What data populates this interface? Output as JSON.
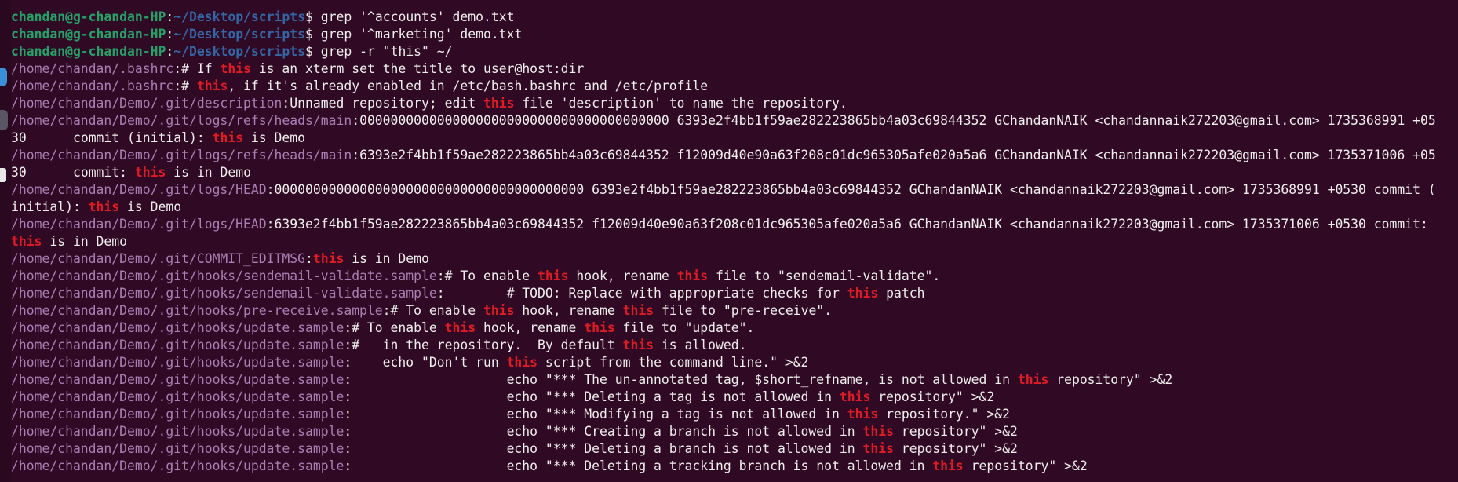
{
  "prompt": {
    "user": "chandan@g-chandan-HP",
    "separator": ":",
    "cwd": "~/Desktop/scripts",
    "dollar": "$ "
  },
  "lines": [
    {
      "kind": "prompt",
      "parts": [
        {
          "t": "grep '^accounts' demo.txt"
        }
      ]
    },
    {
      "kind": "prompt",
      "parts": [
        {
          "t": "grep '^marketing' demo.txt"
        }
      ]
    },
    {
      "kind": "prompt",
      "parts": [
        {
          "t": "grep -r \"this\" ~/"
        }
      ]
    },
    {
      "kind": "output",
      "parts": [
        {
          "t": "/home/chandan/.bashrc",
          "c": "path"
        },
        {
          "t": ":# If "
        },
        {
          "t": "this",
          "c": "hl"
        },
        {
          "t": " is an xterm set the title to user@host:dir"
        }
      ]
    },
    {
      "kind": "output",
      "parts": [
        {
          "t": "/home/chandan/.bashrc",
          "c": "path"
        },
        {
          "t": ":# "
        },
        {
          "t": "this",
          "c": "hl"
        },
        {
          "t": ", if it's already enabled in /etc/bash.bashrc and /etc/profile"
        }
      ]
    },
    {
      "kind": "output",
      "parts": [
        {
          "t": "/home/chandan/Demo/.git/description",
          "c": "path"
        },
        {
          "t": ":Unnamed repository; edit "
        },
        {
          "t": "this",
          "c": "hl"
        },
        {
          "t": " file 'description' to name the repository."
        }
      ]
    },
    {
      "kind": "output",
      "parts": [
        {
          "t": "/home/chandan/Demo/.git/logs/refs/heads/main",
          "c": "path"
        },
        {
          "t": ":0000000000000000000000000000000000000000 6393e2f4bb1f59ae282223865bb4a03c69844352 GChandanNAIK <chandannaik272203@gmail.com> 1735368991 +05"
        }
      ]
    },
    {
      "kind": "output",
      "parts": [
        {
          "t": "30\tcommit (initial): "
        },
        {
          "t": "this",
          "c": "hl"
        },
        {
          "t": " is Demo"
        }
      ]
    },
    {
      "kind": "output",
      "parts": [
        {
          "t": "/home/chandan/Demo/.git/logs/refs/heads/main",
          "c": "path"
        },
        {
          "t": ":6393e2f4bb1f59ae282223865bb4a03c69844352 f12009d40e90a63f208c01dc965305afe020a5a6 GChandanNAIK <chandannaik272203@gmail.com> 1735371006 +05"
        }
      ]
    },
    {
      "kind": "output",
      "parts": [
        {
          "t": "30\tcommit: "
        },
        {
          "t": "this",
          "c": "hl"
        },
        {
          "t": " is in Demo"
        }
      ]
    },
    {
      "kind": "output",
      "parts": [
        {
          "t": "/home/chandan/Demo/.git/logs/HEAD",
          "c": "path"
        },
        {
          "t": ":0000000000000000000000000000000000000000 6393e2f4bb1f59ae282223865bb4a03c69844352 GChandanNAIK <chandannaik272203@gmail.com> 1735368991 +0530 commit ("
        }
      ]
    },
    {
      "kind": "output",
      "parts": [
        {
          "t": "initial): "
        },
        {
          "t": "this",
          "c": "hl"
        },
        {
          "t": " is Demo"
        }
      ]
    },
    {
      "kind": "output",
      "parts": [
        {
          "t": "/home/chandan/Demo/.git/logs/HEAD",
          "c": "path"
        },
        {
          "t": ":6393e2f4bb1f59ae282223865bb4a03c69844352 f12009d40e90a63f208c01dc965305afe020a5a6 GChandanNAIK <chandannaik272203@gmail.com> 1735371006 +0530 commit:"
        }
      ]
    },
    {
      "kind": "output",
      "parts": [
        {
          "t": "this",
          "c": "hl"
        },
        {
          "t": " is in Demo"
        }
      ]
    },
    {
      "kind": "output",
      "parts": [
        {
          "t": "/home/chandan/Demo/.git/COMMIT_EDITMSG",
          "c": "path"
        },
        {
          "t": ":"
        },
        {
          "t": "this",
          "c": "hl"
        },
        {
          "t": " is in Demo"
        }
      ]
    },
    {
      "kind": "output",
      "parts": [
        {
          "t": "/home/chandan/Demo/.git/hooks/sendemail-validate.sample",
          "c": "path"
        },
        {
          "t": ":# To enable "
        },
        {
          "t": "this",
          "c": "hl"
        },
        {
          "t": " hook, rename "
        },
        {
          "t": "this",
          "c": "hl"
        },
        {
          "t": " file to \"sendemail-validate\"."
        }
      ]
    },
    {
      "kind": "output",
      "parts": [
        {
          "t": "/home/chandan/Demo/.git/hooks/sendemail-validate.sample",
          "c": "path"
        },
        {
          "t": ":\t# TODO: Replace with appropriate checks for "
        },
        {
          "t": "this",
          "c": "hl"
        },
        {
          "t": " patch"
        }
      ]
    },
    {
      "kind": "output",
      "parts": [
        {
          "t": "/home/chandan/Demo/.git/hooks/pre-receive.sample",
          "c": "path"
        },
        {
          "t": ":# To enable "
        },
        {
          "t": "this",
          "c": "hl"
        },
        {
          "t": " hook, rename "
        },
        {
          "t": "this",
          "c": "hl"
        },
        {
          "t": " file to \"pre-receive\"."
        }
      ]
    },
    {
      "kind": "output",
      "parts": [
        {
          "t": "/home/chandan/Demo/.git/hooks/update.sample",
          "c": "path"
        },
        {
          "t": ":# To enable "
        },
        {
          "t": "this",
          "c": "hl"
        },
        {
          "t": " hook, rename "
        },
        {
          "t": "this",
          "c": "hl"
        },
        {
          "t": " file to \"update\"."
        }
      ]
    },
    {
      "kind": "output",
      "parts": [
        {
          "t": "/home/chandan/Demo/.git/hooks/update.sample",
          "c": "path"
        },
        {
          "t": ":#   in the repository.  By default "
        },
        {
          "t": "this",
          "c": "hl"
        },
        {
          "t": " is allowed."
        }
      ]
    },
    {
      "kind": "output",
      "parts": [
        {
          "t": "/home/chandan/Demo/.git/hooks/update.sample",
          "c": "path"
        },
        {
          "t": ":    echo \"Don't run "
        },
        {
          "t": "this",
          "c": "hl"
        },
        {
          "t": " script from the command line.\" >&2"
        }
      ]
    },
    {
      "kind": "output",
      "parts": [
        {
          "t": "/home/chandan/Demo/.git/hooks/update.sample",
          "c": "path"
        },
        {
          "t": ":\t\t\techo \"*** The un-annotated tag, $short_refname, is not allowed in "
        },
        {
          "t": "this",
          "c": "hl"
        },
        {
          "t": " repository\" >&2"
        }
      ]
    },
    {
      "kind": "output",
      "parts": [
        {
          "t": "/home/chandan/Demo/.git/hooks/update.sample",
          "c": "path"
        },
        {
          "t": ":\t\t\techo \"*** Deleting a tag is not allowed in "
        },
        {
          "t": "this",
          "c": "hl"
        },
        {
          "t": " repository\" >&2"
        }
      ]
    },
    {
      "kind": "output",
      "parts": [
        {
          "t": "/home/chandan/Demo/.git/hooks/update.sample",
          "c": "path"
        },
        {
          "t": ":\t\t\techo \"*** Modifying a tag is not allowed in "
        },
        {
          "t": "this",
          "c": "hl"
        },
        {
          "t": " repository.\" >&2"
        }
      ]
    },
    {
      "kind": "output",
      "parts": [
        {
          "t": "/home/chandan/Demo/.git/hooks/update.sample",
          "c": "path"
        },
        {
          "t": ":\t\t\techo \"*** Creating a branch is not allowed in "
        },
        {
          "t": "this",
          "c": "hl"
        },
        {
          "t": " repository\" >&2"
        }
      ]
    },
    {
      "kind": "output",
      "parts": [
        {
          "t": "/home/chandan/Demo/.git/hooks/update.sample",
          "c": "path"
        },
        {
          "t": ":\t\t\techo \"*** Deleting a branch is not allowed in "
        },
        {
          "t": "this",
          "c": "hl"
        },
        {
          "t": " repository\" >&2"
        }
      ]
    },
    {
      "kind": "output",
      "parts": [
        {
          "t": "/home/chandan/Demo/.git/hooks/update.sample",
          "c": "path"
        },
        {
          "t": ":\t\t\techo \"*** Deleting a tracking branch is not allowed in "
        },
        {
          "t": "this",
          "c": "hl"
        },
        {
          "t": " repository\" >&2"
        }
      ]
    }
  ],
  "dock": {
    "icons": [
      "app-icon",
      "terminal-icon",
      "files-icon"
    ]
  },
  "colors": {
    "background": "#300a24",
    "prompt_user": "#26a269",
    "prompt_cwd": "#3465a4",
    "path": "#a97fb5",
    "match": "#e01b24",
    "text": "#eeeeec"
  }
}
